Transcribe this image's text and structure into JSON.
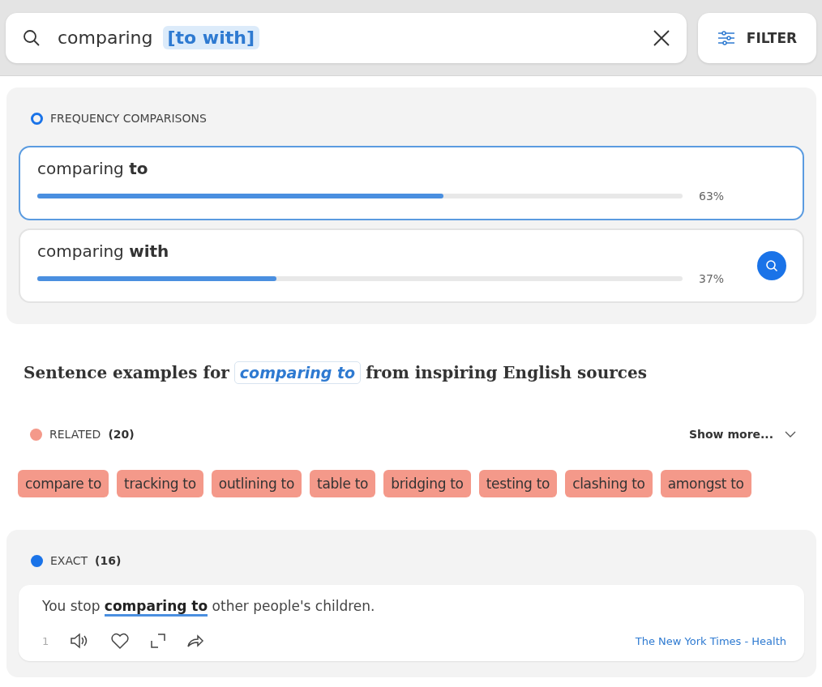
{
  "search": {
    "query": "comparing",
    "pattern": "[to with]",
    "filter_label": "FILTER"
  },
  "frequency": {
    "title": "FREQUENCY COMPARISONS",
    "items": [
      {
        "prefix": "comparing",
        "word": "to",
        "level": 0.63,
        "percent": "63%",
        "selected": true,
        "show_search": false
      },
      {
        "prefix": "comparing",
        "word": "with",
        "level": 0.37,
        "percent": "37%",
        "selected": false,
        "show_search": true
      }
    ]
  },
  "heading": {
    "before": "Sentence examples for",
    "phrase": "comparing to",
    "after": "from inspiring English sources"
  },
  "related": {
    "label": "RELATED",
    "count": "(20)",
    "color": "#f4998a",
    "show_more": "Show more...",
    "tags": [
      "compare to",
      "tracking to",
      "outlining to",
      "table to",
      "bridging to",
      "testing to",
      "clashing to",
      "amongst to"
    ]
  },
  "exact": {
    "label": "EXACT",
    "count": "(16)",
    "color": "#1a73e8",
    "examples": [
      {
        "before": "You stop",
        "match": "comparing to",
        "after": "other people's children.",
        "number": "1",
        "source": "The New York Times - Health"
      }
    ]
  }
}
